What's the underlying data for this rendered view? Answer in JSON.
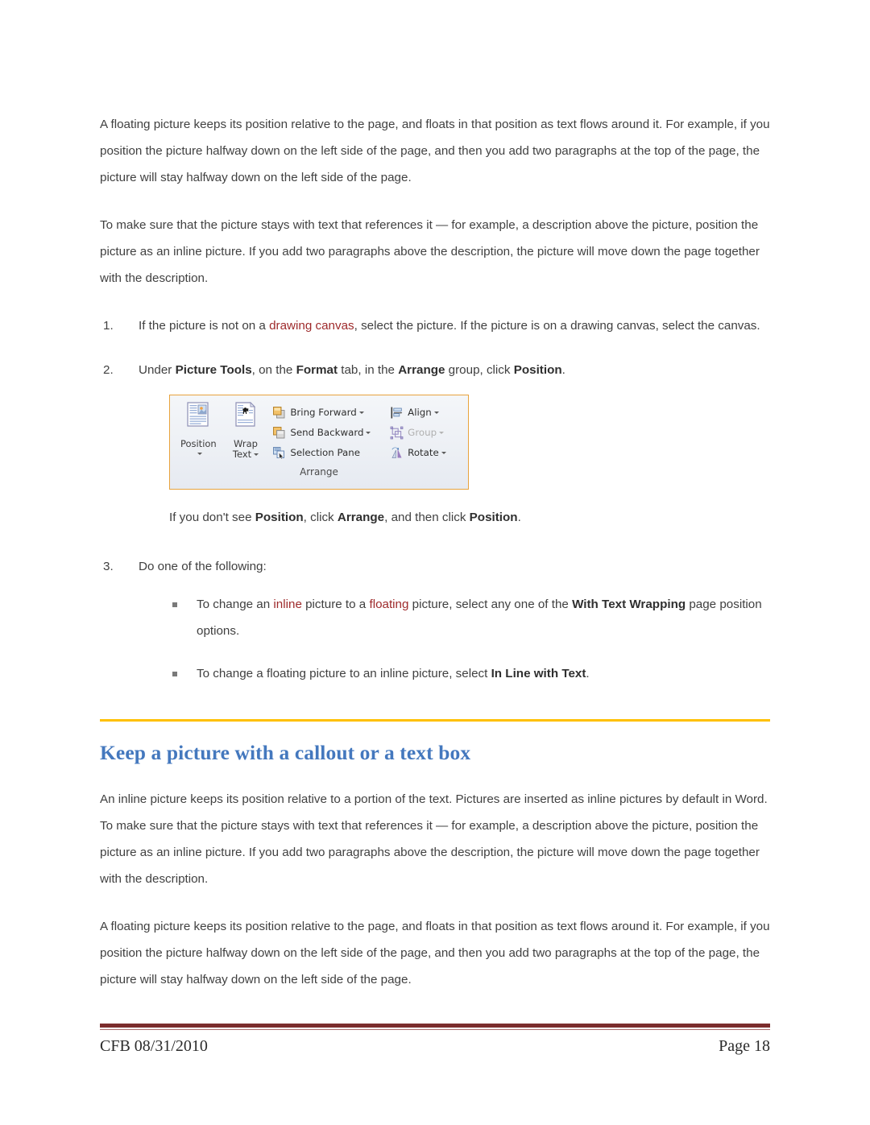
{
  "document": {
    "paragraphs": {
      "p1_a": "A floating picture keeps its position relative to the page, and floats in that position as text flows around it. For example, if you position the picture halfway down on the left side of the page, and then you add two paragraphs at the top of the page, the picture will stay halfway down on the left side of the page.",
      "p2_a": "To make sure that the picture stays with text that references it — for example, a description above the picture, position the picture as an inline picture. If you add two paragraphs above the description, the picture will move down the page together with the description.",
      "p_inline": "An inline picture keeps its position relative to a portion of the text. Pictures are inserted as inline pictures by default in Word. To make sure that the picture stays with text that references it — for example, a description above the picture, position the picture as an inline picture. If you add two paragraphs above the description, the picture will move down the page together with the description.",
      "p_floating": "A floating picture keeps its position relative to the page, and floats in that position as text flows around it. For example, if you position the picture halfway down on the left side of the page, and then you add two paragraphs at the top of the page, the picture will stay halfway down on the left side of the page."
    },
    "numbered_list": {
      "item1": {
        "marker": "1.",
        "text_before": "If the picture is not on a ",
        "accent": "drawing canvas",
        "text_after": ", select the picture. If the picture is on a drawing canvas, select the canvas."
      },
      "item2": {
        "marker": "2.",
        "t1": "Under ",
        "b1": "Picture Tools",
        "t2": ", on the ",
        "b2": "Format",
        "t3": " tab, in the ",
        "b3": "Arrange",
        "t4": " group, click ",
        "b4": "Position",
        "t5": "."
      },
      "item3": {
        "marker": "3.",
        "text": "Do one of the following:"
      }
    },
    "caption_note": {
      "t1": "If you don't see ",
      "b1": "Position",
      "t2": ", click ",
      "b2": "Arrange",
      "t3": ", and then click ",
      "b3": "Position",
      "t4": "."
    },
    "bullets": [
      {
        "t1": "To change an ",
        "a1": "inline",
        "t2": " picture to a ",
        "a2": "floating",
        "t3": " picture, select any one of the ",
        "b1": "With Text Wrapping",
        "t4": " page position options."
      },
      {
        "t1": "To change a floating picture to an inline picture, select ",
        "b1": "In Line with Text",
        "t2": "."
      }
    ],
    "section_heading": "Keep a picture with a callout or a text box",
    "footer": {
      "left": "CFB 08/31/2010",
      "right": "Page 18"
    }
  },
  "ribbon": {
    "group_label": "Arrange",
    "big_buttons": [
      {
        "label_line1": "Position",
        "label_line2": "",
        "icon": "position-icon",
        "has_caret": true
      },
      {
        "label_line1": "Wrap",
        "label_line2": "Text",
        "icon": "wrap-text-icon",
        "has_caret": true
      }
    ],
    "middle_items": [
      {
        "label": "Bring Forward",
        "icon": "bring-forward-icon",
        "has_caret": true,
        "disabled": false
      },
      {
        "label": "Send Backward",
        "icon": "send-backward-icon",
        "has_caret": true,
        "disabled": false
      },
      {
        "label": "Selection Pane",
        "icon": "selection-pane-icon",
        "has_caret": false,
        "disabled": false
      }
    ],
    "right_items": [
      {
        "label": "Align",
        "icon": "align-icon",
        "has_caret": true,
        "disabled": false
      },
      {
        "label": "Group",
        "icon": "group-icon",
        "has_caret": true,
        "disabled": true
      },
      {
        "label": "Rotate",
        "icon": "rotate-icon",
        "has_caret": true,
        "disabled": false
      }
    ]
  },
  "colors": {
    "accent_red": "#9E2A2B",
    "heading_blue": "#4478BE",
    "gold_rule": "#FFC000",
    "footer_maroon": "#7B2C2C",
    "ribbon_border": "#E8A33D"
  }
}
